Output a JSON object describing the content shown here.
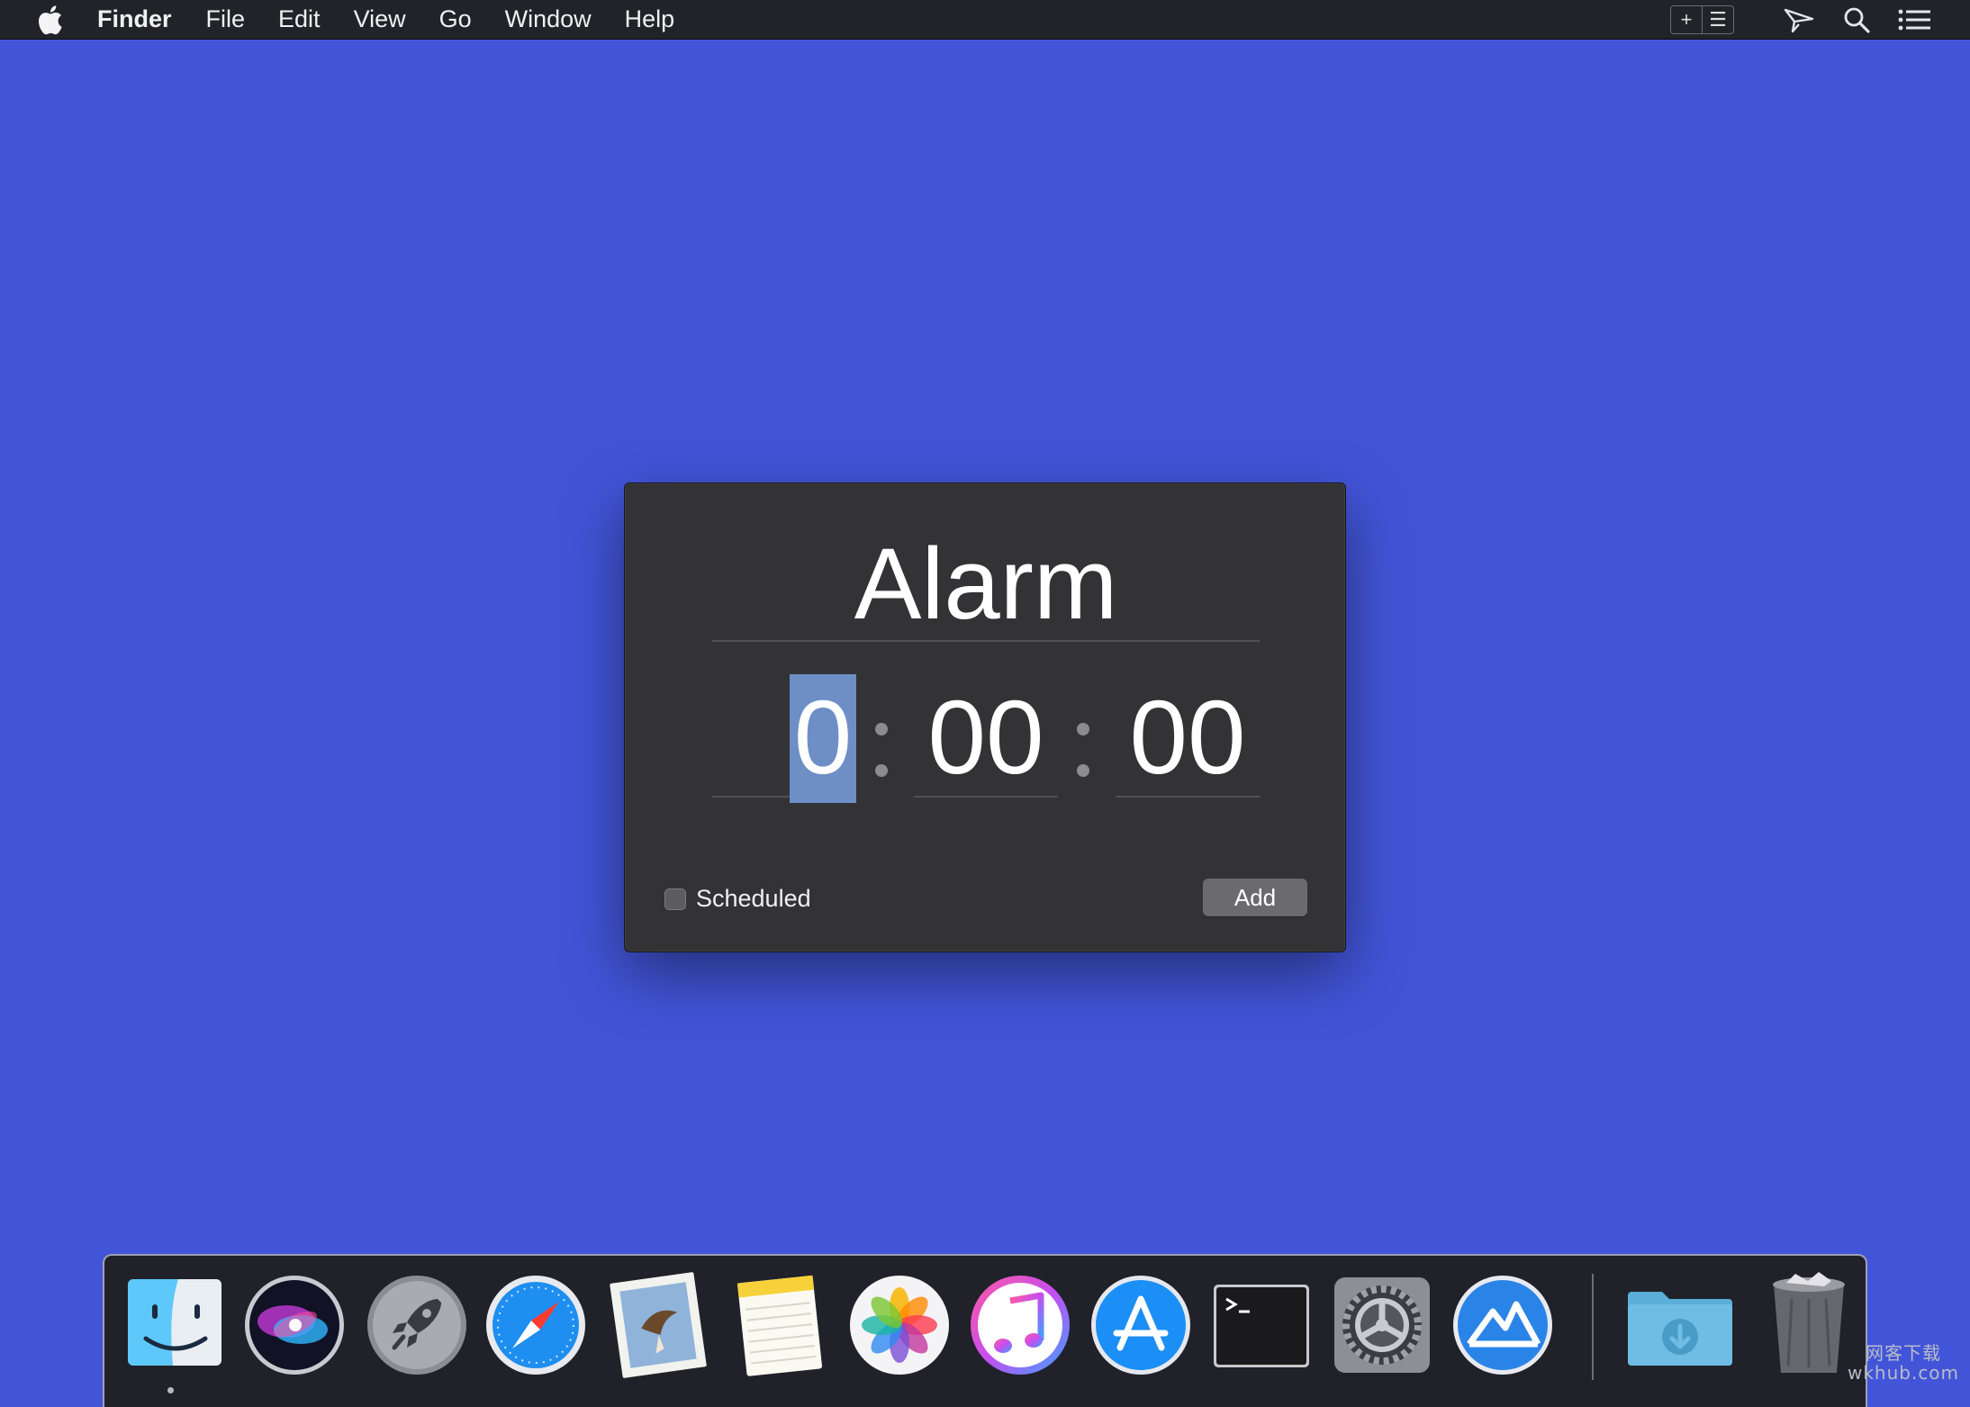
{
  "menubar": {
    "app_name": "Finder",
    "items": [
      "File",
      "Edit",
      "View",
      "Go",
      "Window",
      "Help"
    ],
    "status_group": [
      "+",
      "☰"
    ]
  },
  "alarm": {
    "title": "Alarm",
    "hours": "0",
    "minutes": "00",
    "seconds": "00",
    "scheduled_label": "Scheduled",
    "scheduled_checked": false,
    "add_label": "Add"
  },
  "dock": {
    "apps": [
      "finder-icon",
      "siri-icon",
      "launchpad-icon",
      "safari-icon",
      "mail-icon",
      "notes-icon",
      "photos-icon",
      "itunes-icon",
      "app-store-icon",
      "terminal-icon",
      "system-preferences-icon",
      "mountain-app-icon",
      "downloads-folder-icon",
      "trash-icon"
    ]
  },
  "watermark": {
    "line1": "网客下载",
    "line2": "wkhub.com"
  },
  "colors": {
    "desktop": "#4255d9",
    "menubar": "#222328",
    "window": "#333336",
    "selection": "#6d8fc6"
  }
}
